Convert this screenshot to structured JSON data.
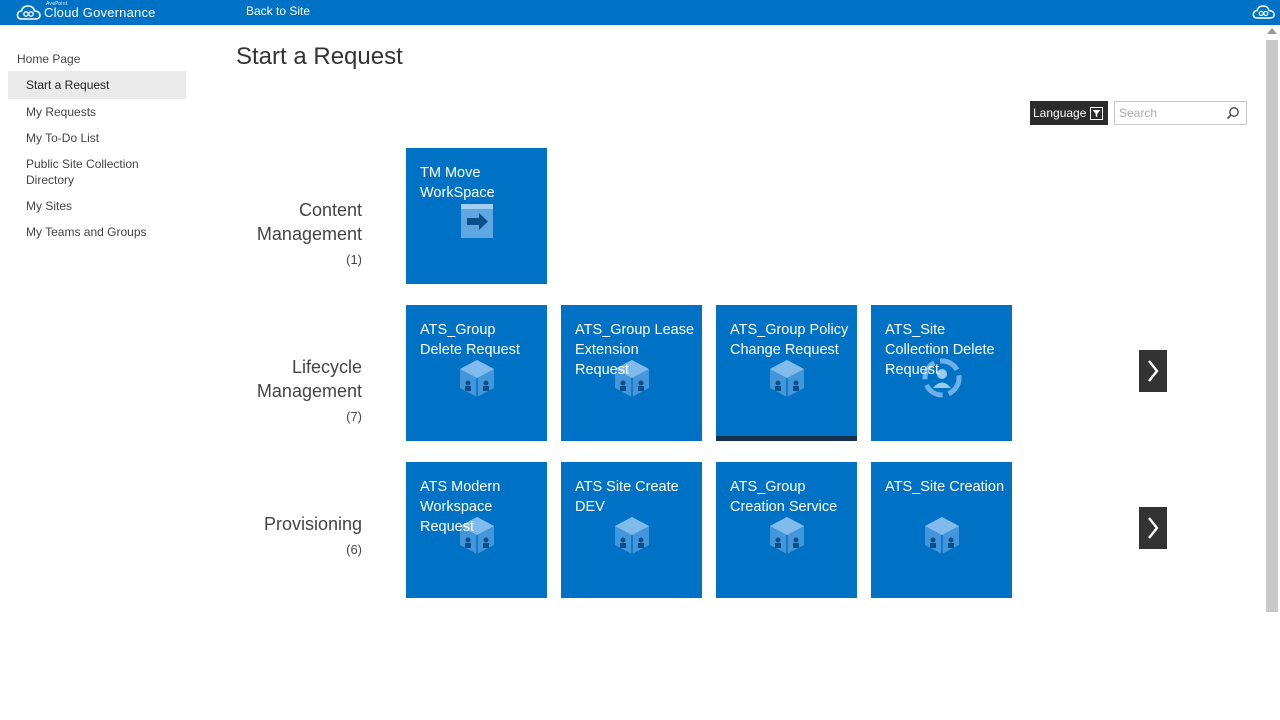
{
  "header": {
    "brand_small": "AvePoint",
    "brand": "Cloud Governance",
    "back_link": "Back to Site",
    "colors": {
      "bar": "#0072c6"
    }
  },
  "sidebar": {
    "items": [
      {
        "label": "Home Page"
      },
      {
        "label": "Start a Request",
        "selected": true
      },
      {
        "label": "My Requests"
      },
      {
        "label": "My To-Do List"
      },
      {
        "label": "Public Site Collection Directory"
      },
      {
        "label": "My Sites"
      },
      {
        "label": "My Teams and Groups"
      }
    ]
  },
  "main": {
    "title": "Start a Request",
    "language_label": "Language",
    "search": {
      "placeholder": "Search",
      "value": ""
    },
    "categories": [
      {
        "name_line1": "Content",
        "name_line2": "Management",
        "count": "(1)",
        "tiles": [
          {
            "title": "TM Move WorkSpace",
            "icon": "move-arrow-icon"
          }
        ]
      },
      {
        "name_line1": "Lifecycle",
        "name_line2": "Management",
        "count": "(7)",
        "tiles": [
          {
            "title": "ATS_Group Delete Request",
            "icon": "cube-icon"
          },
          {
            "title": "ATS_Group Lease Extension Request",
            "icon": "cube-icon"
          },
          {
            "title": "ATS_Group Policy Change Request",
            "icon": "cube-icon"
          },
          {
            "title": "ATS_Site Collection Delete Request",
            "icon": "people-circle-icon"
          }
        ]
      },
      {
        "name_line1": "",
        "name_line2": "Provisioning",
        "count": "(6)",
        "tiles": [
          {
            "title": "ATS Modern Workspace Request",
            "icon": "cube-icon"
          },
          {
            "title": "ATS Site Create DEV",
            "icon": "cube-icon"
          },
          {
            "title": "ATS_Group Creation Service",
            "icon": "cube-icon"
          },
          {
            "title": "ATS_Site Creation",
            "icon": "cube-icon"
          }
        ]
      }
    ],
    "colors": {
      "tile": "#0072c6",
      "tile_selected_bar": "#14304f",
      "arrow_bg": "#333333"
    }
  }
}
